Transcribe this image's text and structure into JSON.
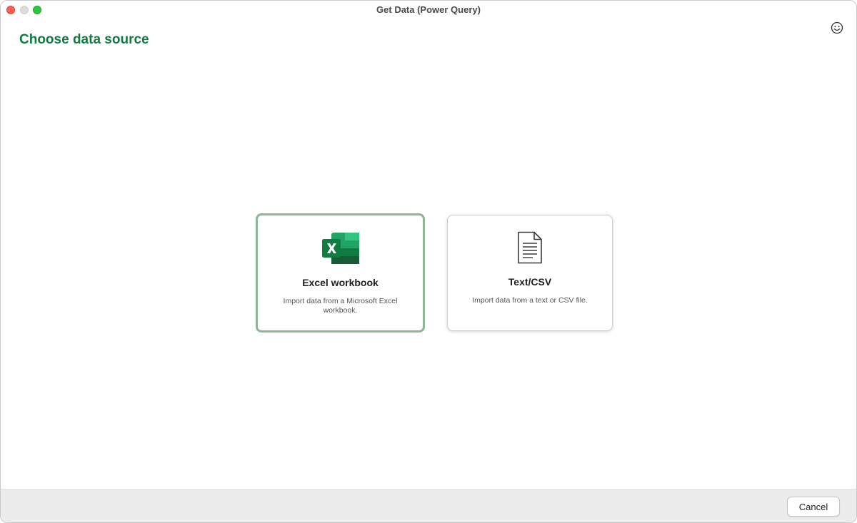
{
  "window": {
    "title": "Get Data (Power Query)"
  },
  "header": {
    "page_title": "Choose data source",
    "feedback_icon": "smiley-feedback-icon"
  },
  "sources": [
    {
      "title": "Excel workbook",
      "description": "Import data from a Microsoft Excel workbook.",
      "icon": "excel-icon",
      "selected": true
    },
    {
      "title": "Text/CSV",
      "description": "Import data from a text or CSV file.",
      "icon": "text-document-icon",
      "selected": false
    }
  ],
  "footer": {
    "cancel_label": "Cancel"
  },
  "colors": {
    "accent_green": "#107c41",
    "selected_border": "#8db596"
  }
}
